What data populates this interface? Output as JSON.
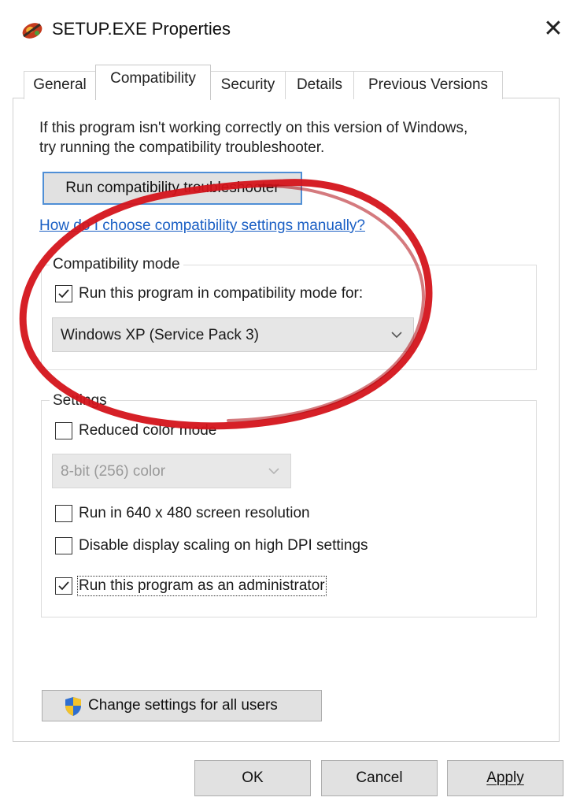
{
  "window": {
    "title": "SETUP.EXE Properties",
    "close_glyph": "✕",
    "icon": "setup-app-icon"
  },
  "tabs": [
    {
      "label": "General",
      "active": false
    },
    {
      "label": "Compatibility",
      "active": true
    },
    {
      "label": "Security",
      "active": false
    },
    {
      "label": "Details",
      "active": false
    },
    {
      "label": "Previous Versions",
      "active": false
    }
  ],
  "compat": {
    "intro_line1": "If this program isn't working correctly on this version of Windows,",
    "intro_line2": "try running the compatibility troubleshooter.",
    "troubleshooter_button": "Run compatibility troubleshooter",
    "help_link": "How do I choose compatibility settings manually?",
    "mode_group": {
      "label": "Compatibility mode",
      "checkbox_label": "Run this program in compatibility mode for:",
      "checked": true,
      "selected_os": "Windows XP (Service Pack 3)"
    },
    "settings_group": {
      "label": "Settings",
      "reduced_color": {
        "label": "Reduced color mode",
        "checked": false
      },
      "color_select": "8-bit (256) color",
      "res_640": {
        "label": "Run in 640 x 480 screen resolution",
        "checked": false
      },
      "dpi": {
        "label": "Disable display scaling on high DPI settings",
        "checked": false
      },
      "admin": {
        "label": "Run this program as an administrator",
        "checked": true
      }
    },
    "all_users_button": "Change settings for all users"
  },
  "footer": {
    "ok": "OK",
    "cancel": "Cancel",
    "apply": "Apply"
  },
  "colors": {
    "link": "#1a5fc4",
    "annotation": "#d4141b",
    "focus": "#4f8fd6"
  }
}
